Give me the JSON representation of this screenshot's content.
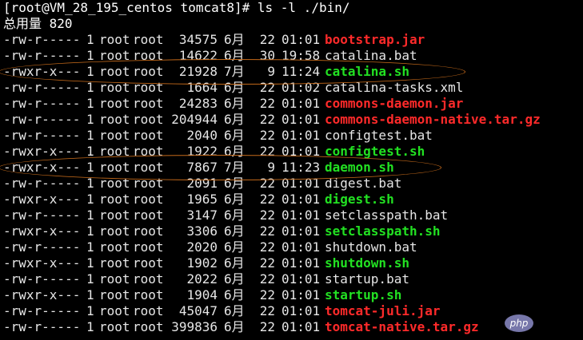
{
  "prompt": "[root@VM_28_195_centos tomcat8]# ls -l ./bin/",
  "total": "总用量 820",
  "colors": {
    "red": "#ff2a2a",
    "green": "#22e022",
    "white": "#e6e6e6",
    "annotation": "#c56a1a"
  },
  "files": [
    {
      "perm": "-rw-r-----",
      "links": "1",
      "owner": "root",
      "group": "root",
      "size": "34575",
      "month": "6月",
      "day": "22",
      "time": "01:01",
      "name": "bootstrap.jar",
      "kind": "jar"
    },
    {
      "perm": "-rw-r-----",
      "links": "1",
      "owner": "root",
      "group": "root",
      "size": "14622",
      "month": "6月",
      "day": "30",
      "time": "19:58",
      "name": "catalina.bat",
      "kind": "plain"
    },
    {
      "perm": "-rwxr-x---",
      "links": "1",
      "owner": "root",
      "group": "root",
      "size": "21928",
      "month": "7月",
      "day": "9",
      "time": "11:24",
      "name": "catalina.sh",
      "kind": "sh"
    },
    {
      "perm": "-rw-r-----",
      "links": "1",
      "owner": "root",
      "group": "root",
      "size": "1664",
      "month": "6月",
      "day": "22",
      "time": "01:02",
      "name": "catalina-tasks.xml",
      "kind": "plain"
    },
    {
      "perm": "-rw-r-----",
      "links": "1",
      "owner": "root",
      "group": "root",
      "size": "24283",
      "month": "6月",
      "day": "22",
      "time": "01:01",
      "name": "commons-daemon.jar",
      "kind": "jar"
    },
    {
      "perm": "-rw-r-----",
      "links": "1",
      "owner": "root",
      "group": "root",
      "size": "204944",
      "month": "6月",
      "day": "22",
      "time": "01:01",
      "name": "commons-daemon-native.tar.gz",
      "kind": "jar"
    },
    {
      "perm": "-rw-r-----",
      "links": "1",
      "owner": "root",
      "group": "root",
      "size": "2040",
      "month": "6月",
      "day": "22",
      "time": "01:01",
      "name": "configtest.bat",
      "kind": "plain"
    },
    {
      "perm": "-rwxr-x---",
      "links": "1",
      "owner": "root",
      "group": "root",
      "size": "1922",
      "month": "6月",
      "day": "22",
      "time": "01:01",
      "name": "configtest.sh",
      "kind": "sh"
    },
    {
      "perm": "-rwxr-x---",
      "links": "1",
      "owner": "root",
      "group": "root",
      "size": "7867",
      "month": "7月",
      "day": "9",
      "time": "11:23",
      "name": "daemon.sh",
      "kind": "sh"
    },
    {
      "perm": "-rw-r-----",
      "links": "1",
      "owner": "root",
      "group": "root",
      "size": "2091",
      "month": "6月",
      "day": "22",
      "time": "01:01",
      "name": "digest.bat",
      "kind": "plain"
    },
    {
      "perm": "-rwxr-x---",
      "links": "1",
      "owner": "root",
      "group": "root",
      "size": "1965",
      "month": "6月",
      "day": "22",
      "time": "01:01",
      "name": "digest.sh",
      "kind": "sh"
    },
    {
      "perm": "-rw-r-----",
      "links": "1",
      "owner": "root",
      "group": "root",
      "size": "3147",
      "month": "6月",
      "day": "22",
      "time": "01:01",
      "name": "setclasspath.bat",
      "kind": "plain"
    },
    {
      "perm": "-rwxr-x---",
      "links": "1",
      "owner": "root",
      "group": "root",
      "size": "3306",
      "month": "6月",
      "day": "22",
      "time": "01:01",
      "name": "setclasspath.sh",
      "kind": "sh"
    },
    {
      "perm": "-rw-r-----",
      "links": "1",
      "owner": "root",
      "group": "root",
      "size": "2020",
      "month": "6月",
      "day": "22",
      "time": "01:01",
      "name": "shutdown.bat",
      "kind": "plain"
    },
    {
      "perm": "-rwxr-x---",
      "links": "1",
      "owner": "root",
      "group": "root",
      "size": "1902",
      "month": "6月",
      "day": "22",
      "time": "01:01",
      "name": "shutdown.sh",
      "kind": "sh"
    },
    {
      "perm": "-rw-r-----",
      "links": "1",
      "owner": "root",
      "group": "root",
      "size": "2022",
      "month": "6月",
      "day": "22",
      "time": "01:01",
      "name": "startup.bat",
      "kind": "plain"
    },
    {
      "perm": "-rwxr-x---",
      "links": "1",
      "owner": "root",
      "group": "root",
      "size": "1904",
      "month": "6月",
      "day": "22",
      "time": "01:01",
      "name": "startup.sh",
      "kind": "sh"
    },
    {
      "perm": "-rw-r-----",
      "links": "1",
      "owner": "root",
      "group": "root",
      "size": "45047",
      "month": "6月",
      "day": "22",
      "time": "01:01",
      "name": "tomcat-juli.jar",
      "kind": "jar"
    },
    {
      "perm": "-rw-r-----",
      "links": "1",
      "owner": "root",
      "group": "root",
      "size": "399836",
      "month": "6月",
      "day": "22",
      "time": "01:01",
      "name": "tomcat-native.tar.gz",
      "kind": "jar"
    }
  ],
  "watermark": "php"
}
